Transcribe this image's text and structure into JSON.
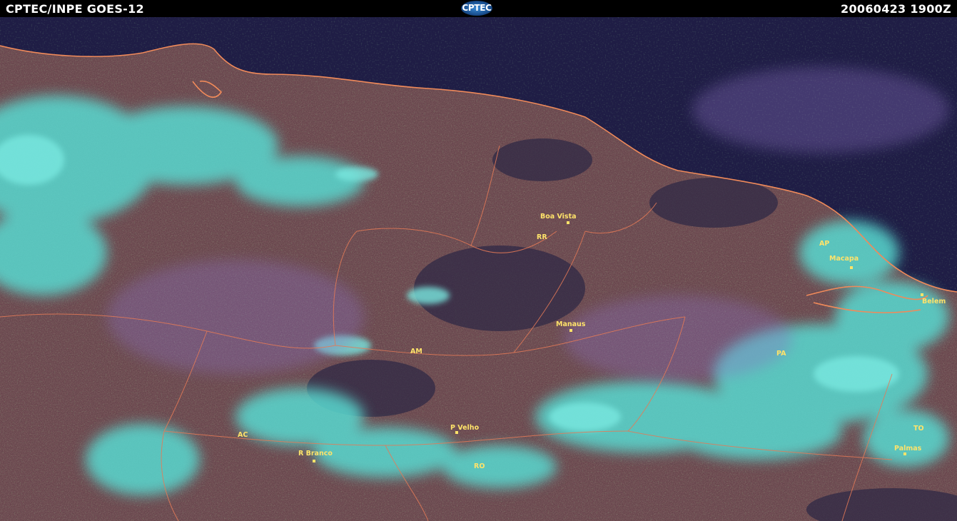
{
  "header": {
    "title": "CPTEC/INPE  GOES-12",
    "logo_text": "CPTEC",
    "timestamp": "20060423  1900Z"
  },
  "map": {
    "states": [
      {
        "id": "rr",
        "label": "RR"
      },
      {
        "id": "ap",
        "label": "AP"
      },
      {
        "id": "am",
        "label": "AM"
      },
      {
        "id": "pa",
        "label": "PA"
      },
      {
        "id": "ac",
        "label": "AC"
      },
      {
        "id": "ro",
        "label": "RO"
      },
      {
        "id": "to",
        "label": "TO"
      }
    ],
    "cities": [
      {
        "id": "boa-vista",
        "label": "Boa Vista"
      },
      {
        "id": "macapa",
        "label": "Macapa"
      },
      {
        "id": "belem",
        "label": "Belem"
      },
      {
        "id": "manaus",
        "label": "Manaus"
      },
      {
        "id": "p-velho",
        "label": "P Velho"
      },
      {
        "id": "r-branco",
        "label": "R Branco"
      },
      {
        "id": "palmas",
        "label": "Palmas"
      }
    ],
    "colors": {
      "ocean": "#1f1d45",
      "land": "#6b4a4a",
      "cloud": "#5ad6d6",
      "border": "#f08a5a",
      "label": "#ffe36a"
    }
  }
}
